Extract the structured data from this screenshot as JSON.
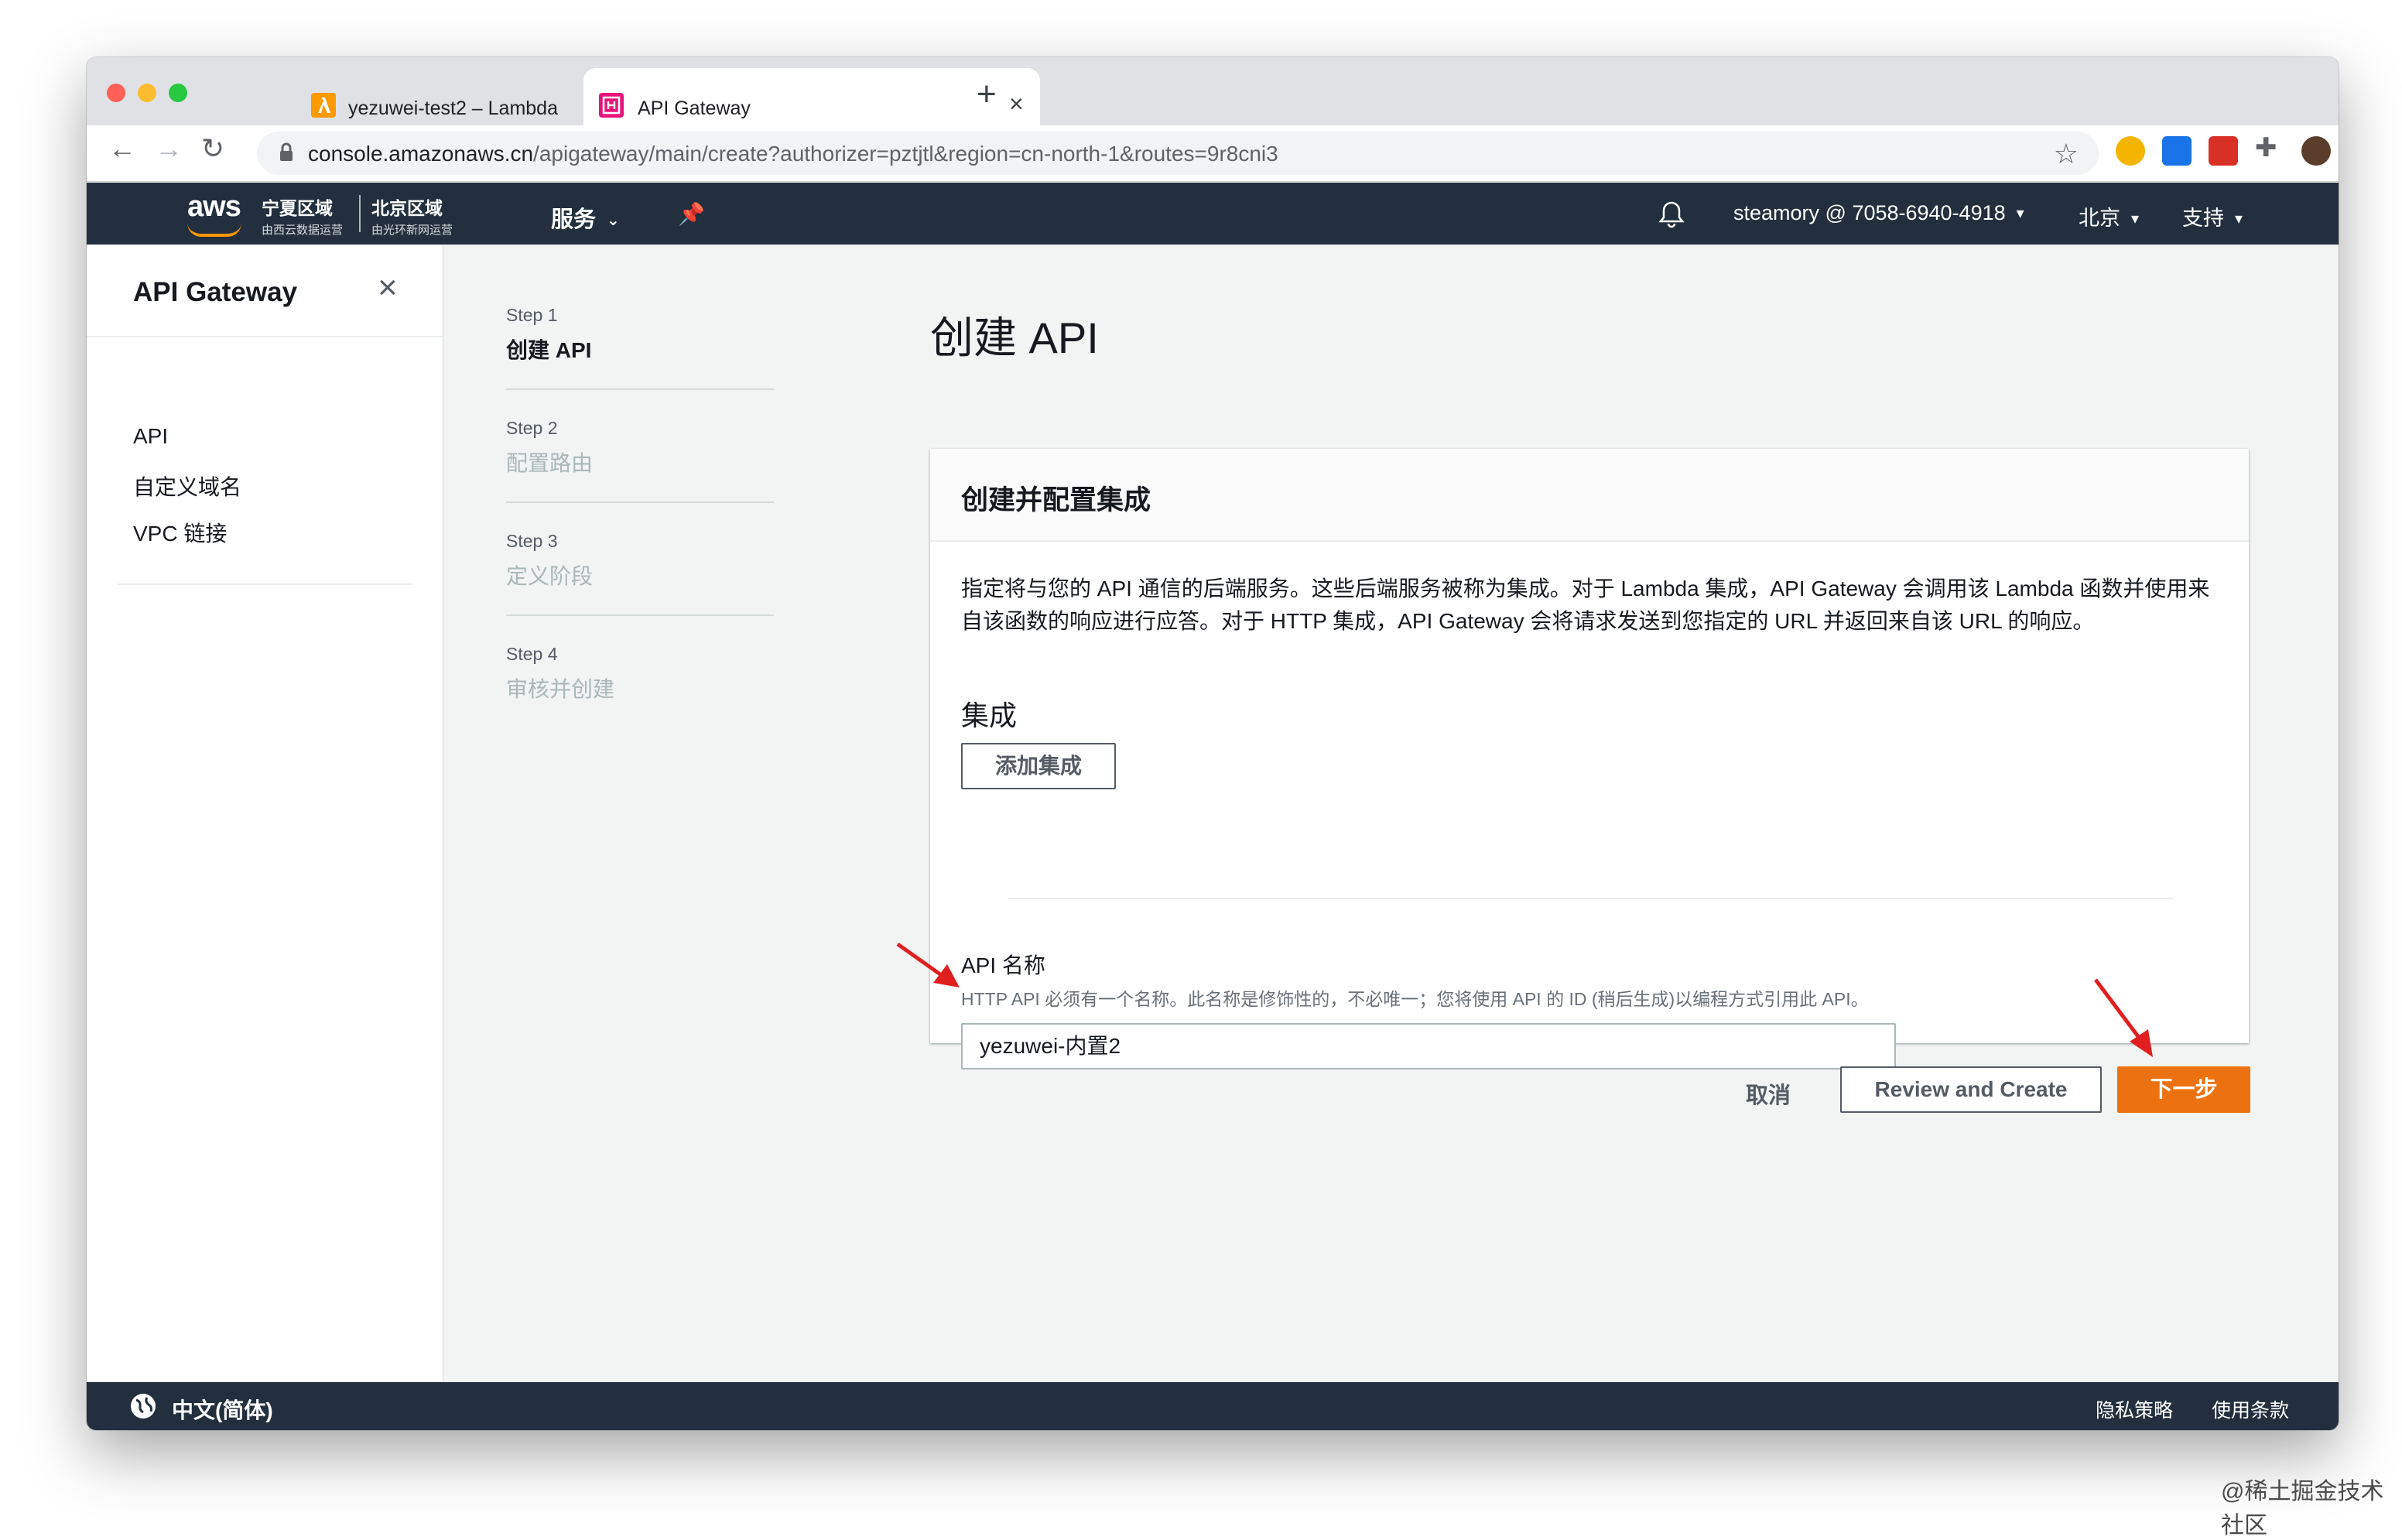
{
  "browser": {
    "tabs": [
      {
        "title": "yezuwei-test2 – Lambda",
        "icon": "lambda-icon",
        "color": "#ff9900"
      },
      {
        "title": "API Gateway",
        "icon": "api-gateway-icon",
        "color": "#e7157b"
      }
    ],
    "url_host": "console.amazonaws.cn",
    "url_path": "/apigateway/main/create?authorizer=pztjtl&region=cn-north-1&routes=9r8cni3"
  },
  "aws_header": {
    "logo": "aws",
    "region1_main": "宁夏区域",
    "region1_sub": "由西云数据运营",
    "region2_main": "北京区域",
    "region2_sub": "由光环新网运营",
    "services_label": "服务",
    "account": "steamory @ 7058-6940-4918",
    "region_menu": "北京",
    "support_menu": "支持",
    "bg_color": "#232f3e",
    "accent_color": "#ff9900"
  },
  "sidebar": {
    "title": "API Gateway",
    "items": [
      "API",
      "自定义域名",
      "VPC 链接"
    ]
  },
  "steps": [
    {
      "num": "Step 1",
      "name": "创建 API",
      "active": true
    },
    {
      "num": "Step 2",
      "name": "配置路由",
      "active": false
    },
    {
      "num": "Step 3",
      "name": "定义阶段",
      "active": false
    },
    {
      "num": "Step 4",
      "name": "审核并创建",
      "active": false
    }
  ],
  "main": {
    "page_title": "创建 API",
    "panel_title": "创建并配置集成",
    "description": "指定将与您的 API 通信的后端服务。这些后端服务被称为集成。对于 Lambda 集成，API Gateway 会调用该 Lambda 函数并使用来自该函数的响应进行应答。对于 HTTP 集成，API Gateway 会将请求发送到您指定的 URL 并返回来自该 URL 的响应。",
    "integrations_title": "集成",
    "add_integration_label": "添加集成",
    "api_name_label": "API 名称",
    "api_name_hint": "HTTP API 必须有一个名称。此名称是修饰性的，不必唯一；您将使用 API 的 ID (稍后生成)以编程方式引用此 API。",
    "api_name_value": "yezuwei-内置2"
  },
  "actions": {
    "cancel_label": "取消",
    "review_label": "Review and Create",
    "next_label": "下一步",
    "primary_color": "#ec7211"
  },
  "footer": {
    "language": "中文(简体)",
    "privacy": "隐私策略",
    "terms": "使用条款"
  },
  "watermark": "@稀土掘金技术社区",
  "annotation_color": "#e02020"
}
